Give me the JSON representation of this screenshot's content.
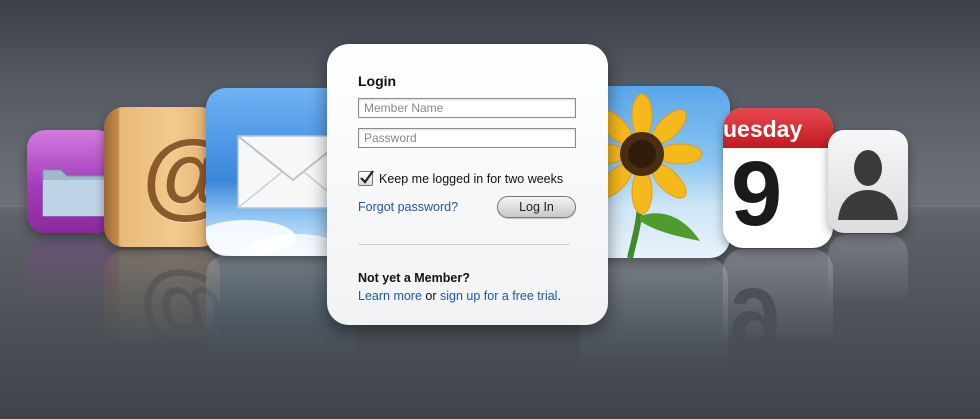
{
  "login": {
    "title": "Login",
    "member_name_placeholder": "Member Name",
    "password_placeholder": "Password",
    "keep_logged_in_label": "Keep me logged in for two weeks",
    "keep_logged_in_checked": true,
    "forgot_password_link": "Forgot password?",
    "login_button": "Log In",
    "not_member_heading": "Not yet a Member?",
    "learn_more_link": "Learn more",
    "or_text": "or",
    "signup_link": "sign up for a free trial",
    "period": "."
  },
  "apps": [
    {
      "name": "folder",
      "icon": "folder-icon"
    },
    {
      "name": "contacts",
      "icon": "at-sign-icon",
      "glyph": "@"
    },
    {
      "name": "mail",
      "icon": "envelope-icon"
    },
    {
      "name": "photos",
      "icon": "sunflower-icon"
    },
    {
      "name": "calendar",
      "icon": "calendar-icon",
      "weekday": "uesday",
      "day": "9"
    },
    {
      "name": "profile",
      "icon": "person-silhouette-icon"
    }
  ],
  "colors": {
    "link": "#1f56a8",
    "calendar_header": "#d5232b",
    "folder_purple": "#a33bb8"
  }
}
